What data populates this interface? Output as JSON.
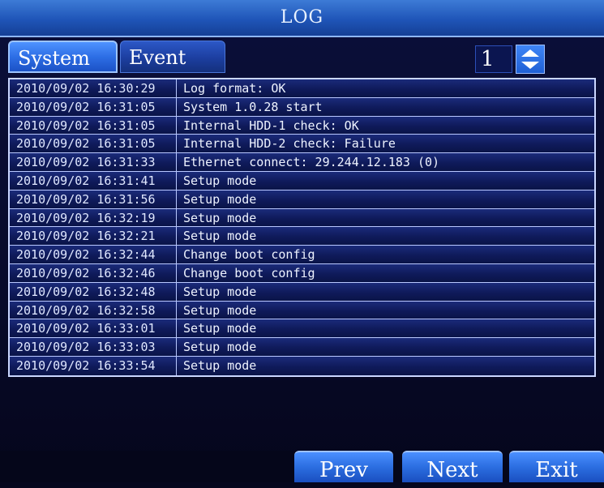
{
  "window": {
    "title": "LOG"
  },
  "tabs": [
    {
      "label": "System",
      "selected": true
    },
    {
      "label": "Event",
      "selected": false
    }
  ],
  "page": {
    "value": "1",
    "spinner_icon": "up-down-spinner-icon"
  },
  "log": {
    "rows": [
      {
        "time": "2010/09/02 16:30:29",
        "message": "Log format: OK"
      },
      {
        "time": "2010/09/02 16:31:05",
        "message": "System 1.0.28 start"
      },
      {
        "time": "2010/09/02 16:31:05",
        "message": "Internal HDD-1 check: OK"
      },
      {
        "time": "2010/09/02 16:31:05",
        "message": "Internal HDD-2 check: Failure"
      },
      {
        "time": "2010/09/02 16:31:33",
        "message": "Ethernet connect: 29.244.12.183 (0)"
      },
      {
        "time": "2010/09/02 16:31:41",
        "message": "Setup mode"
      },
      {
        "time": "2010/09/02 16:31:56",
        "message": "Setup mode"
      },
      {
        "time": "2010/09/02 16:32:19",
        "message": "Setup mode"
      },
      {
        "time": "2010/09/02 16:32:21",
        "message": "Setup mode"
      },
      {
        "time": "2010/09/02 16:32:44",
        "message": "Change boot config"
      },
      {
        "time": "2010/09/02 16:32:46",
        "message": "Change boot config"
      },
      {
        "time": "2010/09/02 16:32:48",
        "message": "Setup mode"
      },
      {
        "time": "2010/09/02 16:32:58",
        "message": "Setup mode"
      },
      {
        "time": "2010/09/02 16:33:01",
        "message": "Setup mode"
      },
      {
        "time": "2010/09/02 16:33:03",
        "message": "Setup mode"
      },
      {
        "time": "2010/09/02 16:33:54",
        "message": "Setup mode"
      }
    ]
  },
  "buttons": {
    "prev": "Prev",
    "next": "Next",
    "exit": "Exit"
  },
  "colors": {
    "title_bar": "#1f55b8",
    "tab_selected": "#2d6ee5",
    "tab_unselected": "#1c3e9f",
    "row_background": "#0f1a5a",
    "grid_lines": "#b9c8ff",
    "text": "#eef3ff"
  }
}
